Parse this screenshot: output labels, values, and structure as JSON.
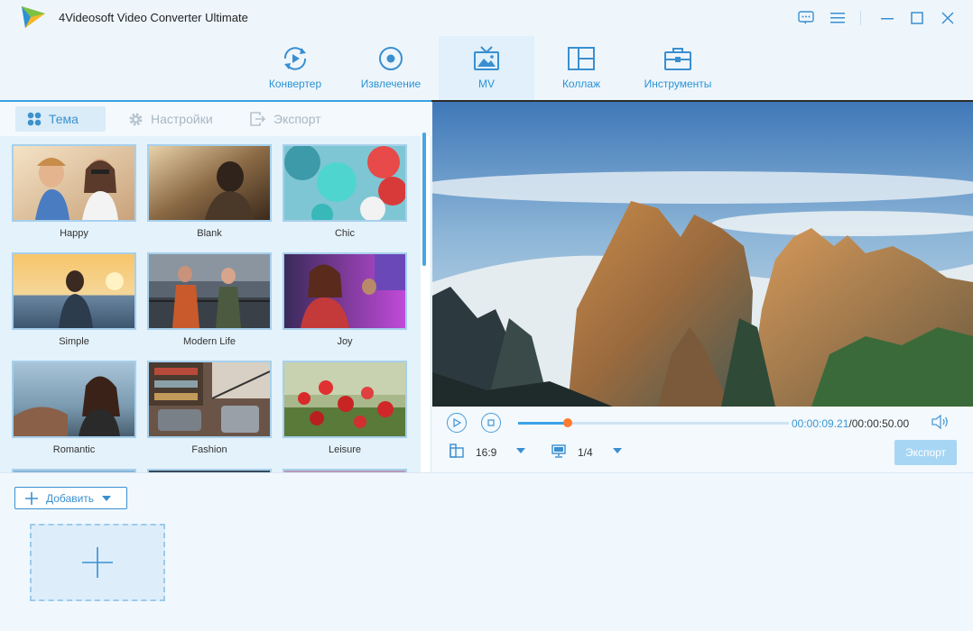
{
  "app": {
    "title": "4Videosoft Video Converter Ultimate"
  },
  "main_tabs": [
    {
      "label": "Конвертер",
      "icon": "convert-icon"
    },
    {
      "label": "Извлечение",
      "icon": "ripper-icon"
    },
    {
      "label": "MV",
      "icon": "mv-icon",
      "active": true
    },
    {
      "label": "Коллаж",
      "icon": "collage-icon"
    },
    {
      "label": "Инструменты",
      "icon": "toolbox-icon"
    }
  ],
  "sub_tabs": [
    {
      "label": "Тема",
      "icon": "theme-icon",
      "active": true
    },
    {
      "label": "Настройки",
      "icon": "settings-gear-icon"
    },
    {
      "label": "Экспорт",
      "icon": "export-icon"
    }
  ],
  "themes": [
    {
      "label": "Happy"
    },
    {
      "label": "Blank"
    },
    {
      "label": "Chic"
    },
    {
      "label": "Simple"
    },
    {
      "label": "Modern Life"
    },
    {
      "label": "Joy"
    },
    {
      "label": "Romantic"
    },
    {
      "label": "Fashion"
    },
    {
      "label": "Leisure"
    }
  ],
  "player": {
    "current_time": "00:00:09.21",
    "total_time": "/00:00:50.00",
    "progress": 0.184,
    "aspect_ratio": "16:9",
    "screen_fraction": "1/4",
    "export_label": "Экспорт"
  },
  "bottom": {
    "add_label": "Добавить"
  },
  "colors": {
    "accent": "#2a93d5",
    "progress": "#3ba3e8",
    "knob": "#ff7b2e",
    "export_disabled": "#a7d6f4"
  }
}
